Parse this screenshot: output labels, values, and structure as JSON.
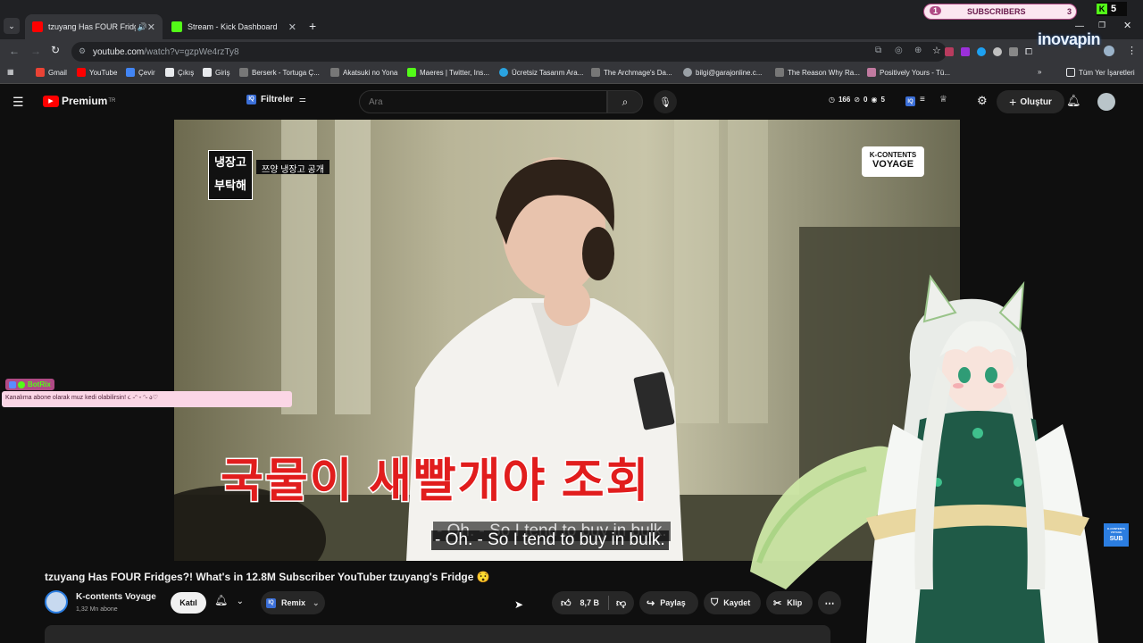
{
  "browser": {
    "tabs": [
      {
        "title": "tzuyang Has FOUR Fridges?",
        "favicon_color": "#ff0000",
        "active": true
      },
      {
        "title": "Stream - Kick Dashboard",
        "favicon_color": "#53fc18",
        "active": false
      }
    ],
    "url_host": "youtube.com",
    "url_path": "/watch?v=gzpWe4rzTy8",
    "bookmarks": [
      "Gmail",
      "YouTube",
      "Çevir",
      "Çıkış",
      "Giriş",
      "Berserk - Tortuga Ç...",
      "Akatsuki no Yona",
      "Maeres | Twitter, Ins...",
      "Ücretsiz Tasarım Ara...",
      "The Archmage's Da...",
      "bilgi@garajonline.c...",
      "The Reason Why Ra...",
      "Positively Yours - Tü..."
    ],
    "all_bookmarks": "Tüm Yer İşaretleri"
  },
  "youtube": {
    "logo_text": "Premium",
    "logo_sup": "TR",
    "filters_label": "Filtreler",
    "search_placeholder": "Ara",
    "stats": {
      "views": "166",
      "a": "0",
      "b": "5"
    },
    "create_label": "Oluştur"
  },
  "video": {
    "show_logo_top": "냉장고",
    "show_logo_bottom": "부탁해",
    "badge_text": "쯔양 냉장고 공개",
    "channel_logo_top": "K-CONTENTS",
    "channel_logo_bottom": "VOYAGE",
    "korean_caption": "국물이 새빨개야 조회",
    "subtitle_ghost": "- Oh. - So I tend to buy in bulk.",
    "subtitle": "- Oh. - So I tend to buy in bulk.",
    "corner_badge_top": "K-CONTENTS VOYAGE",
    "corner_badge_bottom": "SUB"
  },
  "details": {
    "title": "tzuyang Has FOUR Fridges?! What's in 12.8M Subscriber YouTuber tzuyang's Fridge 😯",
    "channel_name": "K-contents Voyage",
    "subscribers": "1,32 Mn abone",
    "join_label": "Katıl",
    "remix_label": "Remix",
    "likes": "8,7 B",
    "share_label": "Paylaş",
    "save_label": "Kaydet",
    "clip_label": "Klip"
  },
  "overlays": {
    "botrix_name": "BotRix",
    "botrix_message": "Kanalıma abone olarak muz kedi olabilirsin! ૮ ˶ᵔ ᵕ ᵔ˶ ა♡",
    "subs_left": "1",
    "subs_label": "SUBSCRIBERS",
    "subs_right": "3",
    "kick_count": "5",
    "inova_text": "inovapin"
  },
  "colors": {
    "yt_red": "#ff0000",
    "kick_green": "#53fc18",
    "caption_red": "#e11d1d"
  }
}
